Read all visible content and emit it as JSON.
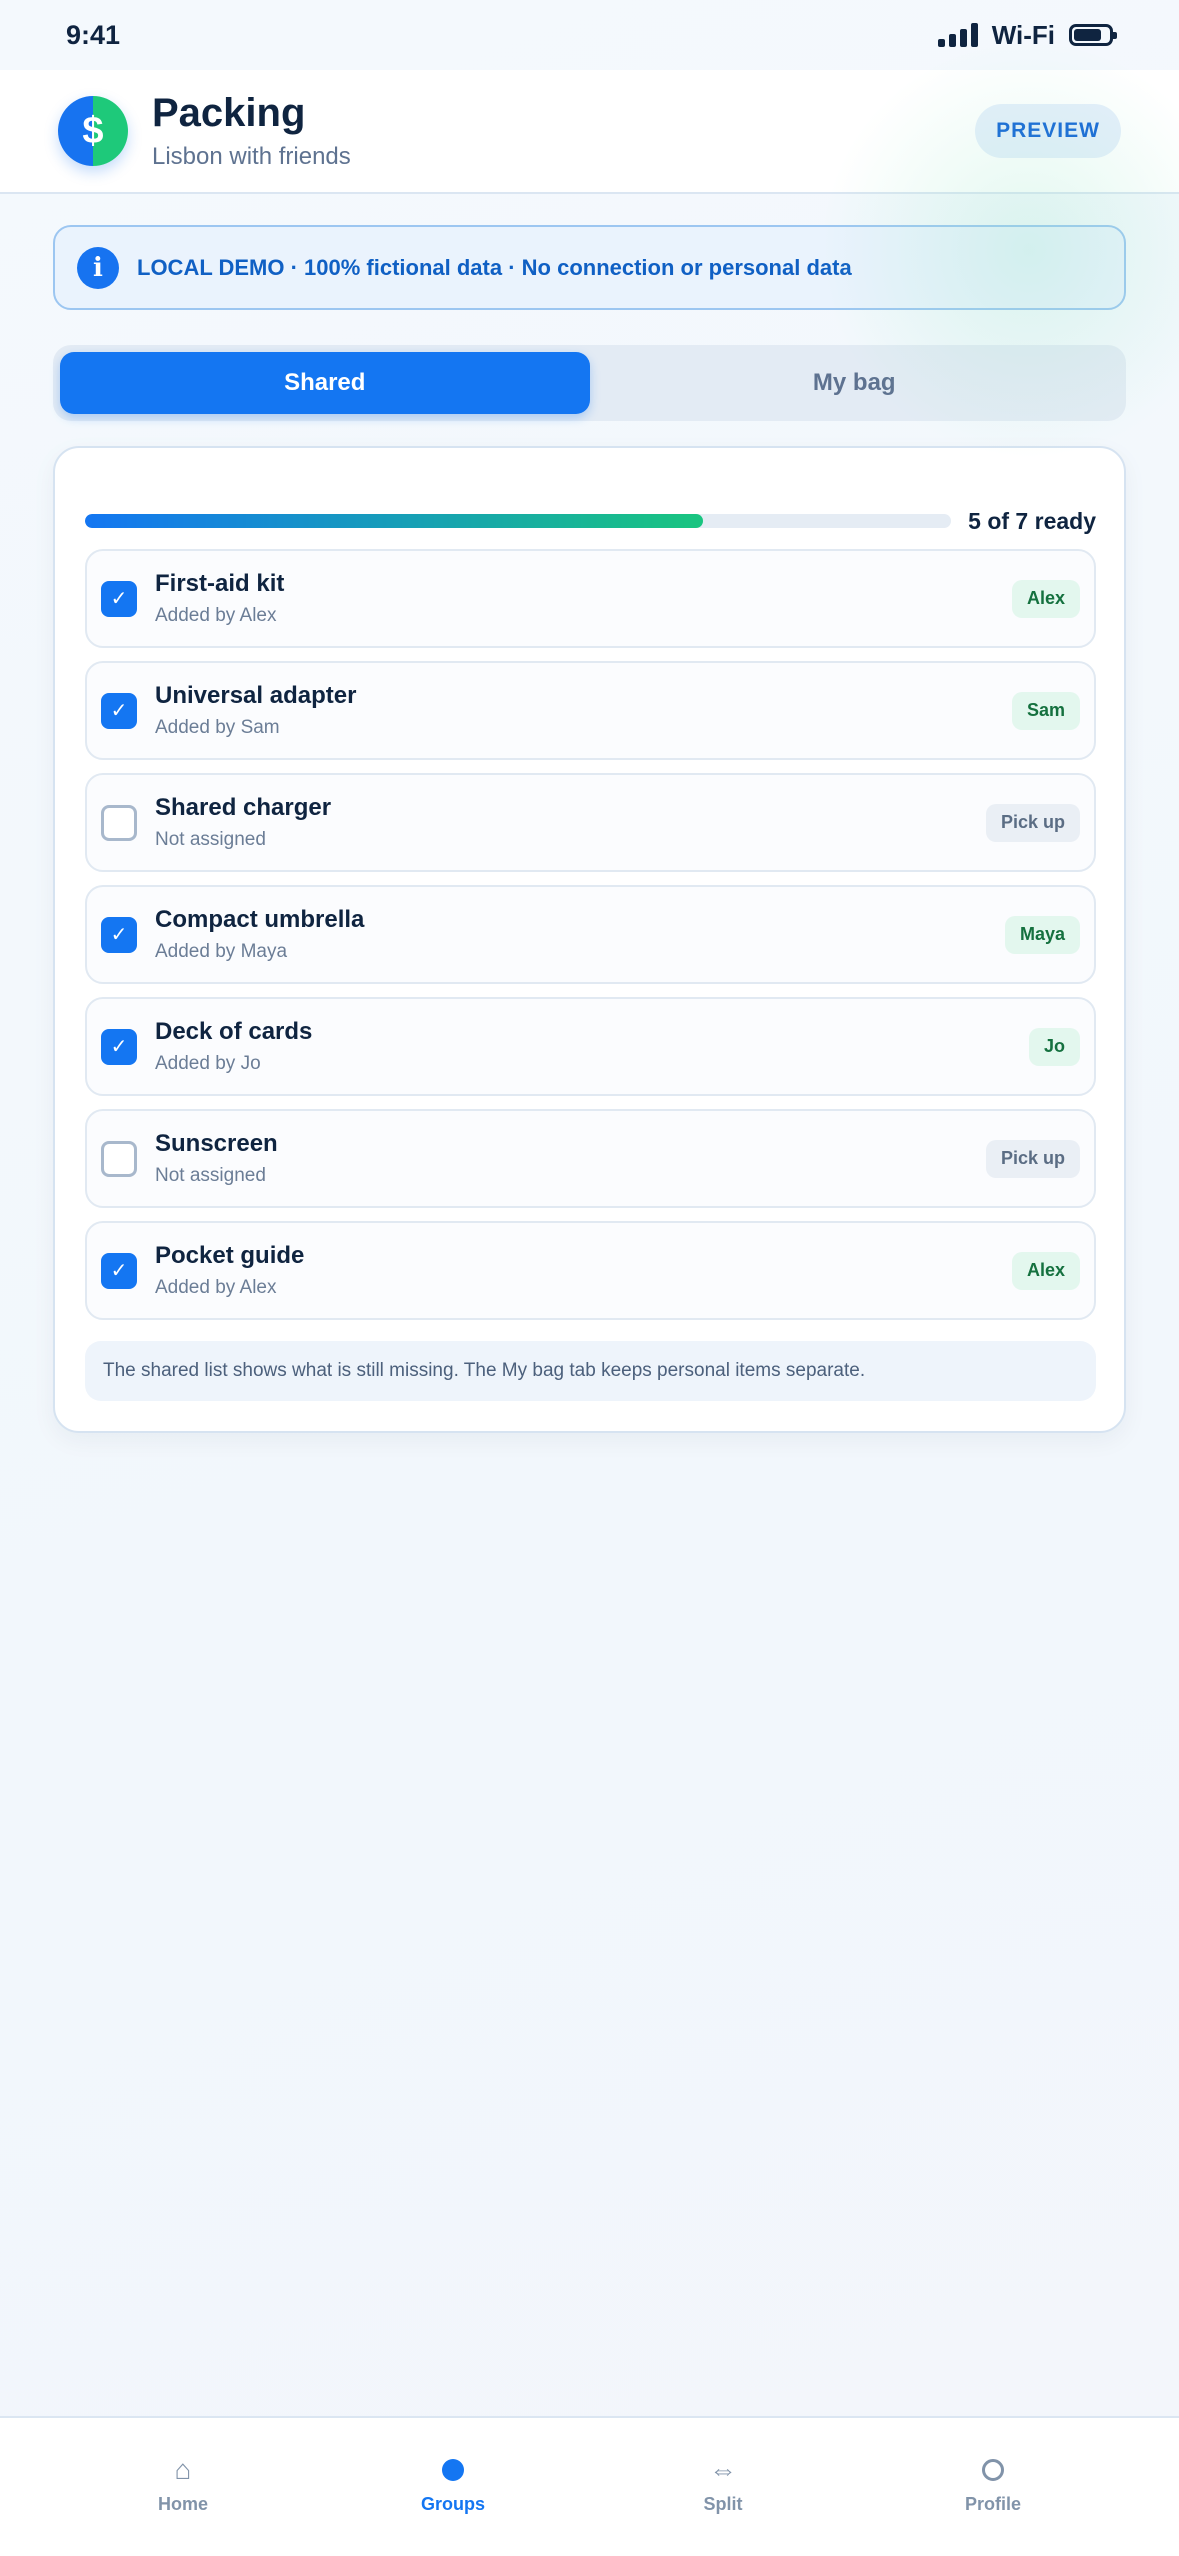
{
  "status_bar": {
    "time": "9:41",
    "wifi": "Wi-Fi"
  },
  "header": {
    "title": "Packing",
    "subtitle": "Lisbon with friends",
    "logo_glyph": "$",
    "preview_label": "PREVIEW"
  },
  "banner": {
    "icon_glyph": "i",
    "text": "LOCAL DEMO · 100% fictional data · No connection or personal data"
  },
  "tabs": [
    {
      "label": "Shared",
      "active": true
    },
    {
      "label": "My bag",
      "active": false
    }
  ],
  "progress": {
    "label": "5 of 7 ready",
    "fraction": 0.714
  },
  "items": [
    {
      "name": "First-aid kit",
      "sub": "Added by Alex",
      "checked": true,
      "badge": "Alex"
    },
    {
      "name": "Universal adapter",
      "sub": "Added by Sam",
      "checked": true,
      "badge": "Sam"
    },
    {
      "name": "Shared charger",
      "sub": "Not assigned",
      "checked": false,
      "badge": "Pick up"
    },
    {
      "name": "Compact umbrella",
      "sub": "Added by Maya",
      "checked": true,
      "badge": "Maya"
    },
    {
      "name": "Deck of cards",
      "sub": "Added by Jo",
      "checked": true,
      "badge": "Jo"
    },
    {
      "name": "Sunscreen",
      "sub": "Not assigned",
      "checked": false,
      "badge": "Pick up"
    },
    {
      "name": "Pocket guide",
      "sub": "Added by Alex",
      "checked": true,
      "badge": "Alex"
    }
  ],
  "check_glyph": "✓",
  "note": "The shared list shows what is still missing. The My bag tab keeps personal items separate.",
  "bottom_nav": [
    {
      "label": "Home",
      "icon": "home-icon",
      "glyph": "⌂",
      "active": false
    },
    {
      "label": "Groups",
      "icon": "groups-icon",
      "glyph": "",
      "active": true
    },
    {
      "label": "Split",
      "icon": "split-icon",
      "glyph": "⇔",
      "active": false
    },
    {
      "label": "Profile",
      "icon": "profile-icon",
      "glyph": "",
      "active": false
    }
  ],
  "colors": {
    "accent": "#1476f2",
    "success": "#19c57f",
    "text": "#0f2440",
    "muted": "#5e7290"
  }
}
